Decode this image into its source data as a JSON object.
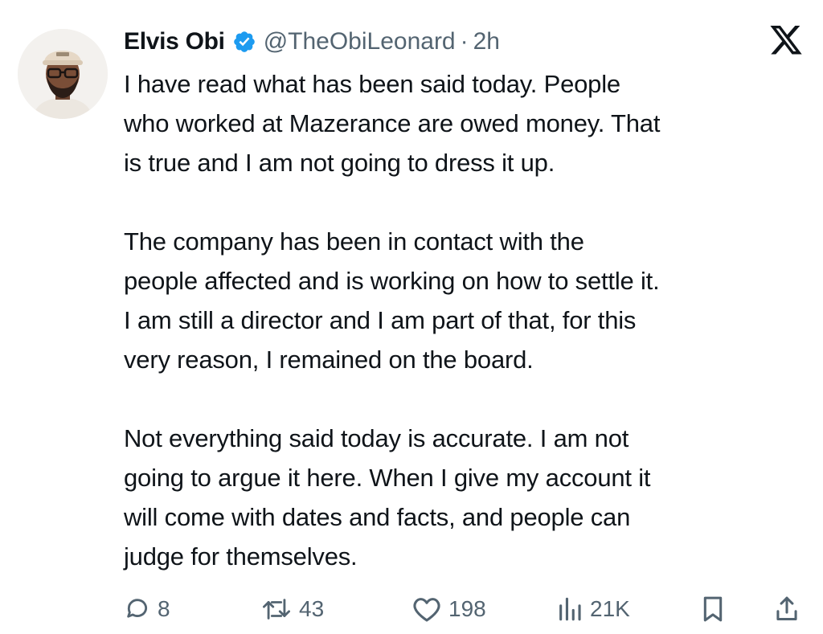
{
  "author": {
    "name": "Elvis Obi",
    "handle": "@TheObiLeonard",
    "separator": "·",
    "time": "2h",
    "verified": true
  },
  "platform_icon": "x-logo-icon",
  "post": {
    "paragraphs": [
      {
        "lines": [
          "I have read what has been said today. People",
          "who worked at Mazerance are owed money. That",
          "is true and I am not going to dress it up."
        ]
      },
      {
        "lines": [
          "The company has been in contact with the",
          "people affected and is working on how to settle it.",
          "I am still a director and I am part of that, for this",
          "very reason, I remained on the board."
        ]
      },
      {
        "lines": [
          "Not everything said today is accurate. I am not",
          "going to argue it here. When I give my account it",
          "will come with dates and facts, and people can",
          "judge for themselves."
        ]
      }
    ]
  },
  "actions": {
    "replies": {
      "icon": "reply-icon",
      "count": "8"
    },
    "reposts": {
      "icon": "repost-icon",
      "count": "43"
    },
    "likes": {
      "icon": "heart-icon",
      "count": "198"
    },
    "views": {
      "icon": "views-icon",
      "count": "21K"
    },
    "bookmark": {
      "icon": "bookmark-icon"
    },
    "share": {
      "icon": "share-icon"
    }
  },
  "colors": {
    "text": "#0f1419",
    "secondary": "#536471",
    "verified": "#1d9bf0"
  }
}
